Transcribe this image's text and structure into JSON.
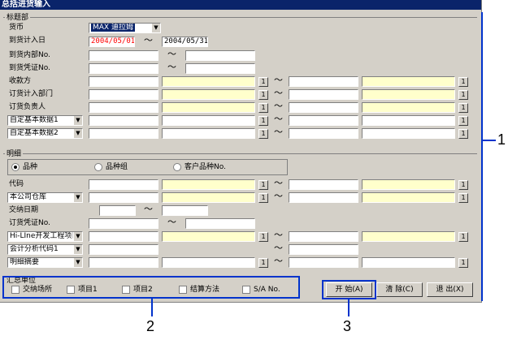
{
  "window": {
    "title": "总括进货输入"
  },
  "header_group": {
    "label": "标题部",
    "currency_label": "货币",
    "currency_value": "MAX 迪拉姆",
    "arrival_date_label": "到货计入日",
    "arrival_date_from": "2004/05/01",
    "arrival_date_to": "2004/05/31",
    "arrival_internal_no_label": "到货内部No.",
    "arrival_voucher_no_label": "到货凭证No.",
    "payee_label": "收款方",
    "order_dept_label": "订货计入部门",
    "order_person_label": "订货负责人",
    "custom_basic_data_1": "自定基本数据1",
    "custom_basic_data_2": "自定基本数据2"
  },
  "detail_group": {
    "label": "明细",
    "radio_item": "品种",
    "radio_item_group": "品种组",
    "radio_customer_item_no": "客户品种No.",
    "code_label": "代码",
    "warehouse_select": "本公司仓库",
    "delivery_date_label": "交纳日期",
    "order_voucher_no_label": "订货凭证No.",
    "project_select": "Hi-LIne开发工程项目",
    "accounting_code_select": "会计分析代码1",
    "detail_summary_select": "明细摘要"
  },
  "summary_group": {
    "label": "汇总单位",
    "checkboxes": [
      "交纳场所",
      "项目1",
      "项目2",
      "结算方法",
      "S/A No."
    ]
  },
  "buttons": {
    "start": "开 始(A)",
    "clear": "清 除(C)",
    "exit": "退 出(X)",
    "lookup": "1"
  },
  "tilde": "～",
  "callouts": [
    "1",
    "2",
    "3"
  ],
  "colors": {
    "callout": "#0033cc",
    "title_bar": "#0a246a",
    "highlight_field": "#ffffcc"
  }
}
